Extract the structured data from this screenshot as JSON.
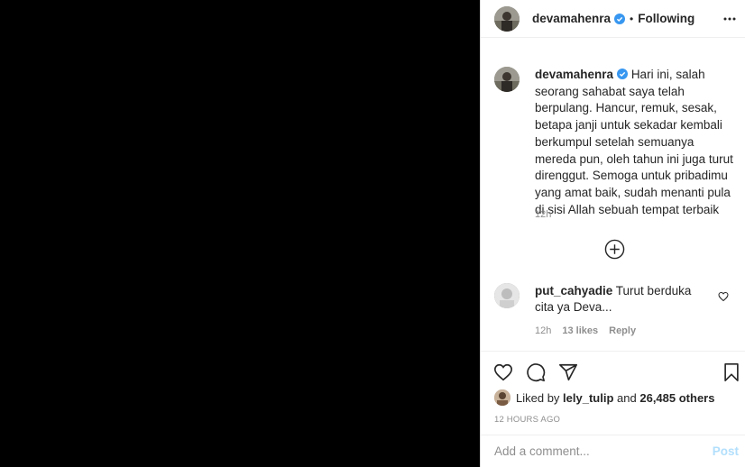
{
  "post": {
    "author": "devamahenra",
    "follow_status": "Following",
    "separator": "•"
  },
  "caption": {
    "username": "devamahenra",
    "text": "Hari ini, salah seorang sahabat saya telah berpulang. Hancur, remuk, sesak, betapa janji untuk sekadar kembali berkumpul setelah semuanya mereda pun, oleh tahun ini juga turut direnggut. Semoga untuk pribadimu yang amat baik, sudah menanti pula di sisi Allah sebuah tempat terbaik",
    "time": "12h"
  },
  "comments": [
    {
      "username": "put_cahyadie",
      "text": "Turut berduka cita ya Deva...",
      "time": "12h",
      "likes": "13 likes",
      "reply": "Reply"
    }
  ],
  "likes": {
    "prefix": "Liked by",
    "user": "lely_tulip",
    "middle": "and",
    "others": "26,485 others"
  },
  "posted_ago": "12 HOURS AGO",
  "add_comment": {
    "placeholder": "Add a comment...",
    "post_label": "Post"
  },
  "icons": {
    "verified": "verified-badge-icon",
    "more": "more-options-icon",
    "load_more": "plus-circle-icon",
    "like": "heart-icon",
    "comment": "comment-icon",
    "share": "share-icon",
    "save": "bookmark-icon"
  },
  "colors": {
    "verified": "#3897f0",
    "post_disabled": "#b2dffc",
    "muted": "#8e8e8e"
  }
}
